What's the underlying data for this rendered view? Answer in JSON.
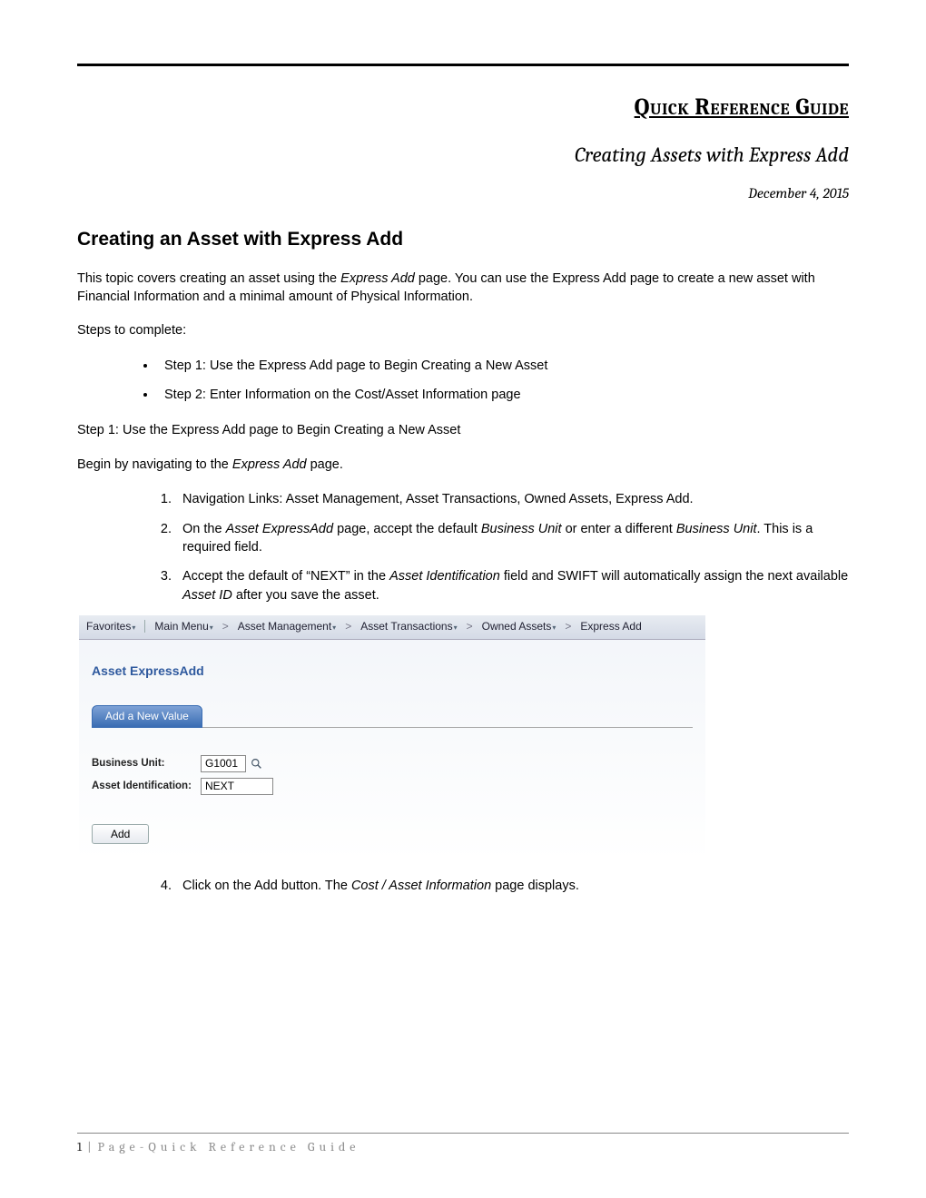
{
  "header": {
    "title": "Quick Reference Guide",
    "subtitle": "Creating Assets with Express Add",
    "date": "December 4, 2015"
  },
  "section": {
    "heading": "Creating an Asset with Express Add",
    "intro_before": "This topic covers creating an asset using the ",
    "intro_em": "Express Add",
    "intro_after": " page. You can use the Express Add page to create a new asset with Financial Information and a minimal amount of Physical Information.",
    "steps_label": "Steps to complete:",
    "bullets": [
      "Step 1: Use the Express Add page to Begin Creating a New Asset",
      "Step 2: Enter Information on the Cost/Asset Information page"
    ],
    "step1_heading": "Step 1: Use the Express Add page to Begin Creating a New Asset",
    "step1_intro_before": "Begin by navigating to the ",
    "step1_intro_em": "Express Add",
    "step1_intro_after": " page.",
    "numbered_1": "Navigation Links: Asset Management, Asset Transactions, Owned Assets, Express Add.",
    "numbered_2_a": "On the ",
    "numbered_2_em1": "Asset ExpressAdd",
    "numbered_2_b": " page, accept the default ",
    "numbered_2_em2": "Business Unit",
    "numbered_2_c": " or enter a different ",
    "numbered_2_em3": "Business Unit",
    "numbered_2_d": ". This is a required field.",
    "numbered_3_a": "Accept the default of “NEXT” in the ",
    "numbered_3_em1": "Asset Identification",
    "numbered_3_b": " field and SWIFT will automatically assign the next available ",
    "numbered_3_em2": "Asset ID",
    "numbered_3_c": " after you save the asset.",
    "numbered_4_a": "Click on the Add button. The ",
    "numbered_4_em": "Cost / Asset Information",
    "numbered_4_b": " page displays."
  },
  "app": {
    "breadcrumb": {
      "favorites": "Favorites",
      "main_menu": "Main Menu",
      "asset_mgmt": "Asset Management",
      "asset_trans": "Asset Transactions",
      "owned_assets": "Owned Assets",
      "express_add": "Express Add"
    },
    "page_title": "Asset ExpressAdd",
    "tab_label": "Add a New Value",
    "fields": {
      "bu_label": "Business Unit:",
      "bu_value": "G1001",
      "aid_label": "Asset Identification:",
      "aid_value": "NEXT"
    },
    "add_button": "Add"
  },
  "footer": {
    "page_num": "1",
    "pipe": "|",
    "text": "Page-Quick Reference Guide"
  }
}
